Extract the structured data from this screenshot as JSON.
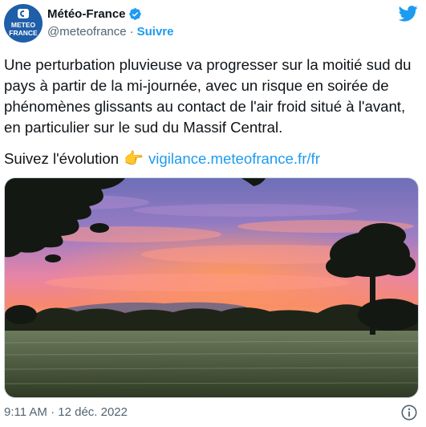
{
  "account": {
    "display_name": "Météo-France",
    "handle": "@meteofrance",
    "separator": "·",
    "follow_label": "Suivre",
    "avatar_text": "METEO\nFRANCE",
    "verified": true
  },
  "tweet": {
    "text": "Une perturbation pluvieuse va progresser sur la moitié sud du pays à partir de la mi-journée, avec un risque en soirée de phénomènes glissants au contact de l'air froid situé à l'avant, en particulier sur le sud du Massif Central.",
    "follow_prefix": "Suivez l'évolution",
    "follow_emoji": "👉",
    "link_text": "vigilance.meteofrance.fr/fr"
  },
  "media": {
    "type": "photo",
    "description_icon": "sunset-landscape"
  },
  "footer": {
    "time": "9:11 AM · 12 déc. 2022"
  },
  "icons": {
    "brand": "twitter-bird-icon",
    "verified": "verified-badge-icon",
    "info": "info-icon"
  },
  "colors": {
    "accent": "#1d9bf0",
    "text": "#0f1419",
    "muted": "#536471",
    "avatar_bg": "#1f5ea8"
  }
}
